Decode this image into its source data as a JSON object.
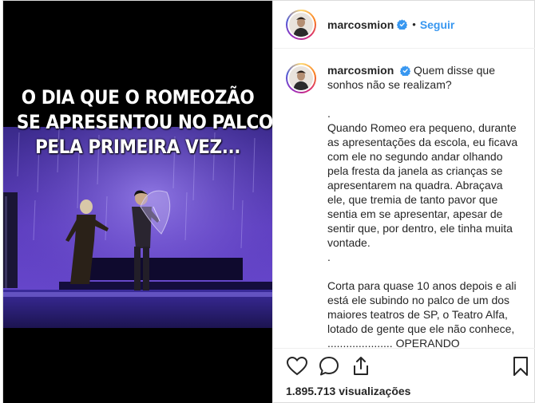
{
  "media": {
    "overlay_lines": [
      "O DIA QUE O ROMEOZÃO",
      "SE APRESENTOU NO PALCO",
      "PELA PRIMEIRA VEZ..."
    ]
  },
  "header": {
    "avatar_icon": "profile-avatar",
    "username": "marcosmion",
    "verified_icon": "verified-badge-icon",
    "separator": "•",
    "follow_label": "Seguir"
  },
  "caption": {
    "username": "marcosmion",
    "lines": [
      "Quem disse que",
      "sonhos não se realizam?",
      "",
      ".",
      "Quando Romeo era pequeno, durante",
      "as apresentações da escola, eu ficava",
      "com ele no segundo andar olhando",
      "pela fresta da janela as crianças se",
      "apresentarem na quadra. Abraçava",
      "ele, que tremia de tanto pavor que",
      "sentia em se apresentar, apesar de",
      "sentir que, por dentro, ele tinha muita",
      "vontade.",
      ".",
      "",
      "Corta para quase 10 anos depois e ali",
      "está ele subindo no palco de um dos",
      "maiores teatros de SP, o Teatro Alfa,",
      "lotado de gente que ele não conhece,",
      "..................... OPERANDO"
    ]
  },
  "actions": {
    "like_icon": "heart-icon",
    "comment_icon": "comment-icon",
    "share_icon": "share-icon",
    "save_icon": "bookmark-icon",
    "views_count": "1.895.713",
    "views_label": "visualizações"
  },
  "colors": {
    "link_blue": "#3897f0",
    "verified_blue": "#3897f0",
    "border": "#dbdbdb"
  }
}
